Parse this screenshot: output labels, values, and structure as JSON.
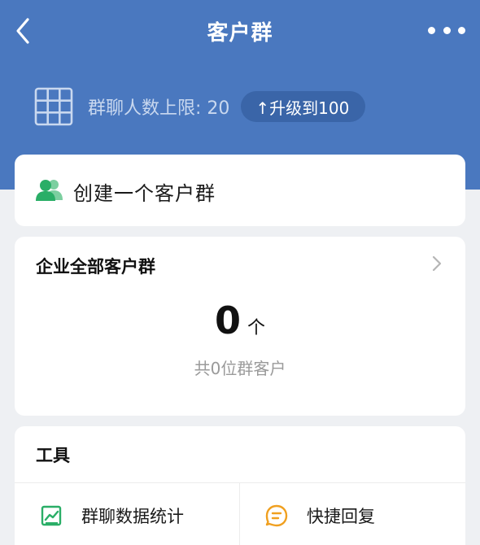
{
  "header": {
    "title": "客户群",
    "back_icon": "chevron-left-icon",
    "more_icon": "more-dots-icon"
  },
  "limit": {
    "text": "群聊人数上限: 20",
    "upgrade_label": "↑升级到100",
    "icon": "grid-icon"
  },
  "create": {
    "label": "创建一个客户群",
    "icon": "users-icon"
  },
  "groups": {
    "title": "企业全部客户群",
    "count": "0",
    "unit": "个",
    "total_text": "共0位群客户"
  },
  "tools": {
    "title": "工具",
    "items": [
      {
        "label": "群聊数据统计",
        "icon": "chart-icon"
      },
      {
        "label": "快捷回复",
        "icon": "chat-bubble-icon"
      }
    ]
  },
  "colors": {
    "header_blue": "#4a78bf",
    "upgrade_pill": "#3a65a8",
    "green": "#2aae67",
    "orange": "#f0a020"
  }
}
